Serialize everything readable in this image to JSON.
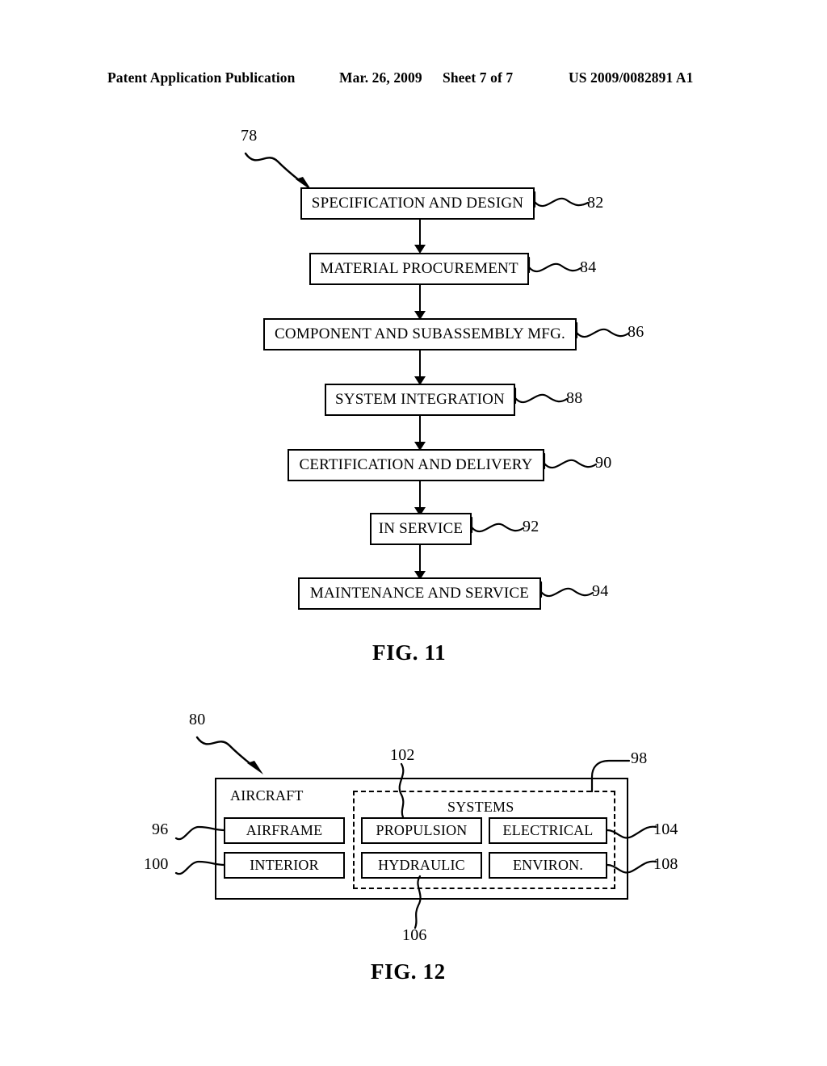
{
  "header": {
    "left": "Patent Application Publication",
    "date": "Mar. 26, 2009",
    "sheet": "Sheet 7 of 7",
    "pubnum": "US 2009/0082891 A1"
  },
  "fig11": {
    "caption": "FIG. 11",
    "diagram_ref": "78",
    "steps": [
      {
        "label": "SPECIFICATION AND DESIGN",
        "ref": "82"
      },
      {
        "label": "MATERIAL PROCUREMENT",
        "ref": "84"
      },
      {
        "label": "COMPONENT AND SUBASSEMBLY MFG.",
        "ref": "86"
      },
      {
        "label": "SYSTEM INTEGRATION",
        "ref": "88"
      },
      {
        "label": "CERTIFICATION AND DELIVERY",
        "ref": "90"
      },
      {
        "label": "IN SERVICE",
        "ref": "92"
      },
      {
        "label": "MAINTENANCE AND SERVICE",
        "ref": "94"
      }
    ]
  },
  "fig12": {
    "caption": "FIG. 12",
    "diagram_ref": "80",
    "aircraft_label": "AIRCRAFT",
    "systems_label": "SYSTEMS",
    "systems_ref": "98",
    "components": [
      {
        "label": "AIRFRAME",
        "ref": "96"
      },
      {
        "label": "INTERIOR",
        "ref": "100"
      },
      {
        "label": "PROPULSION",
        "ref": "102"
      },
      {
        "label": "ELECTRICAL",
        "ref": "104"
      },
      {
        "label": "HYDRAULIC",
        "ref": "106"
      },
      {
        "label": "ENVIRON.",
        "ref": "108"
      }
    ]
  },
  "colors": {
    "ink": "#000000",
    "paper": "#ffffff"
  }
}
